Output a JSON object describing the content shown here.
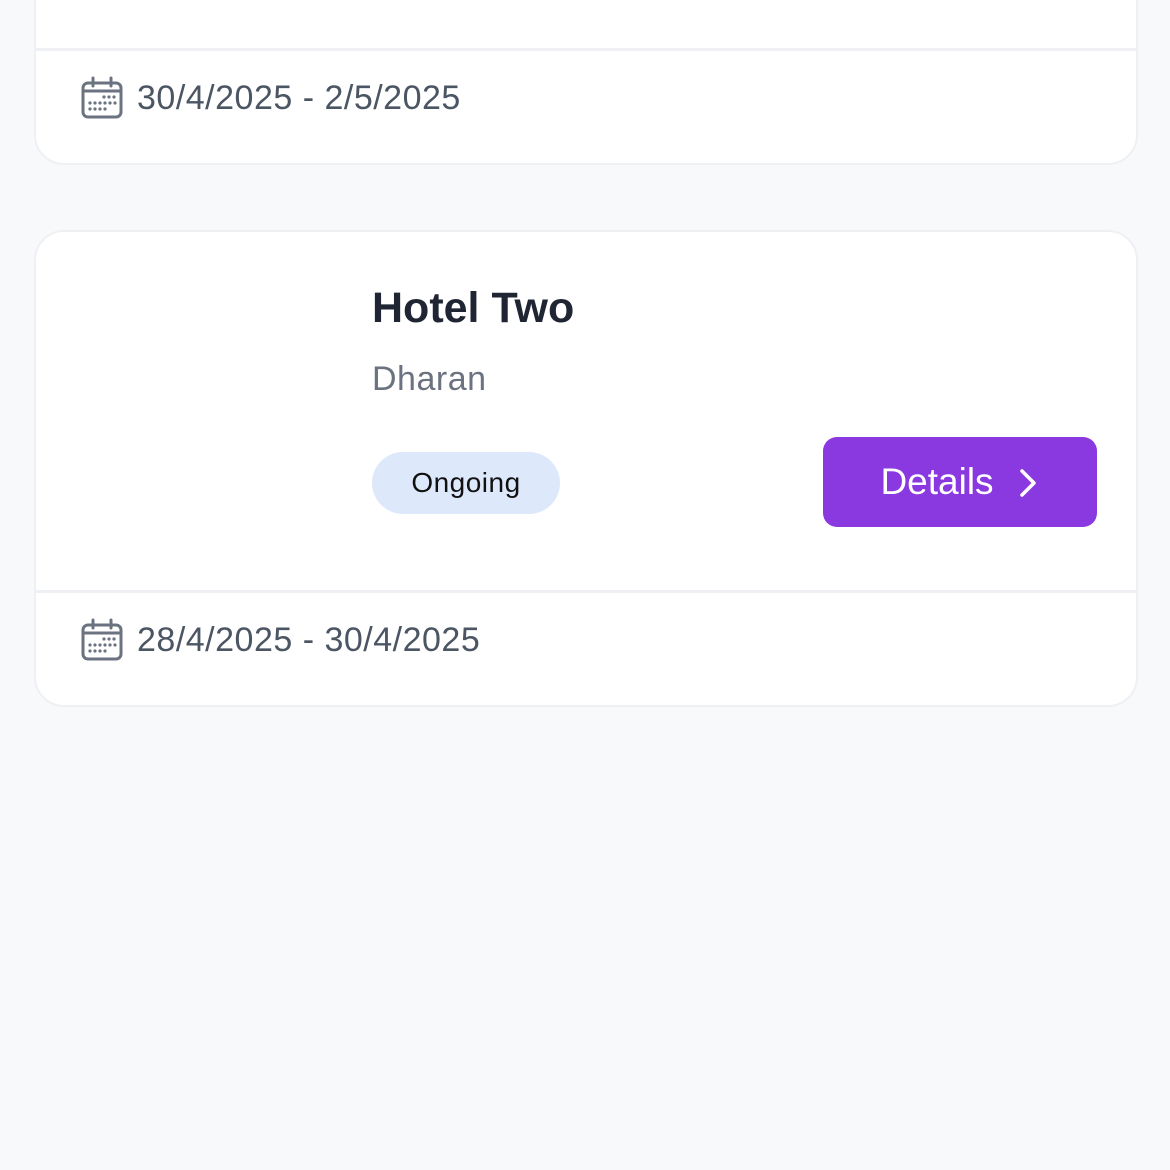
{
  "bookings": [
    {
      "date_range": "30/4/2025 - 2/5/2025"
    },
    {
      "hotel_name": "Hotel Two",
      "location": "Dharan",
      "status": "Ongoing",
      "details_label": "Details",
      "date_range": "28/4/2025 - 30/4/2025"
    }
  ],
  "colors": {
    "accent": "#8a38e0",
    "badge_bg": "#dde8fb",
    "page_bg": "#f8f9fb"
  },
  "icons": {
    "date": "calendar-icon",
    "details": "chevron-right-icon"
  }
}
